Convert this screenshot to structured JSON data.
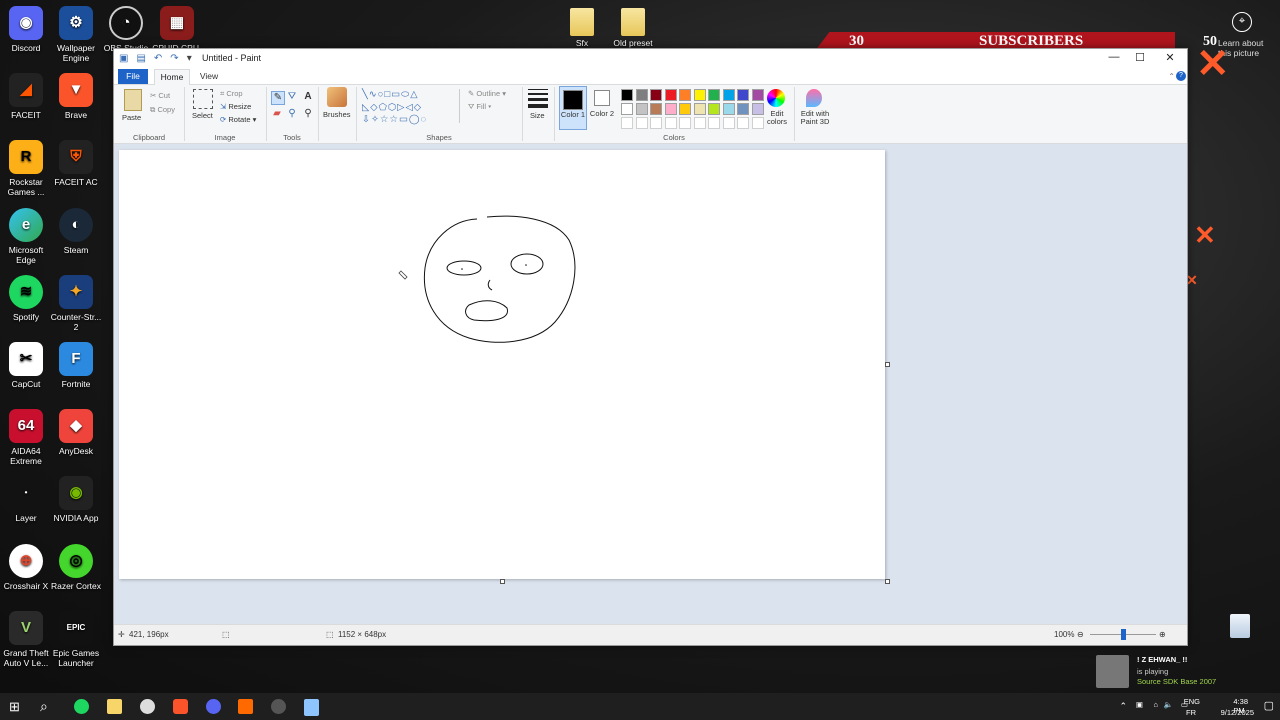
{
  "desktop": {
    "col1": [
      "Discord",
      "FACEIT",
      "Rockstar Games ...",
      "Microsoft Edge",
      "Spotify",
      "CapCut",
      "AIDA64 Extreme",
      "Layer",
      "Crosshair X",
      "Grand Theft Auto V Le..."
    ],
    "col2": [
      "Wallpaper Engine",
      "Brave",
      "FACEIT AC",
      "Steam",
      "Counter-Str... 2",
      "Fortnite",
      "AnyDesk",
      "NVIDIA App",
      "Razer Cortex",
      "Epic Games Launcher"
    ],
    "col3": [
      "OBS Studio"
    ],
    "col4": [
      "CPUID CPU-Z"
    ],
    "folders": [
      "Sfx",
      "Old preset"
    ]
  },
  "overlay": {
    "sub_count": "30",
    "sub_label": "SUBSCRIBERS",
    "sub_count_2": "50",
    "learn_about": "Learn about this picture"
  },
  "paint": {
    "title": "Untitled - Paint",
    "tabs": {
      "file": "File",
      "home": "Home",
      "view": "View"
    },
    "clipboard": {
      "paste": "Paste",
      "cut": "Cut",
      "copy": "Copy",
      "label": "Clipboard"
    },
    "image": {
      "select": "Select",
      "crop": "Crop",
      "resize": "Resize",
      "rotate": "Rotate",
      "label": "Image"
    },
    "tools_label": "Tools",
    "brushes": "Brushes",
    "shapes": {
      "outline": "Outline",
      "fill": "Fill",
      "label": "Shapes"
    },
    "size": "Size",
    "color1": "Color 1",
    "color2": "Color 2",
    "colors_label": "Colors",
    "edit_colors": "Edit colors",
    "edit_paint3d": "Edit with Paint 3D",
    "status": {
      "cursor": "421, 196px",
      "dimensions": "1152 × 648px",
      "zoom": "100%"
    }
  },
  "palette_row1": [
    "#000000",
    "#7f7f7f",
    "#880015",
    "#ed1c24",
    "#ff7f27",
    "#fff200",
    "#22b14c",
    "#00a2e8",
    "#3f48cc",
    "#a349a4"
  ],
  "palette_row2": [
    "#ffffff",
    "#c3c3c3",
    "#b97a57",
    "#ffaec9",
    "#ffc90e",
    "#efe4b0",
    "#b5e61d",
    "#99d9ea",
    "#7092be",
    "#c8bfe7"
  ],
  "notification": {
    "name": "! Z EHWAN_ !!",
    "status": "is playing",
    "game": "Source SDK Base 2007"
  },
  "tray": {
    "lang1": "ENG",
    "lang2": "FR",
    "time": "4:38 PM",
    "date": "9/12/2025"
  }
}
